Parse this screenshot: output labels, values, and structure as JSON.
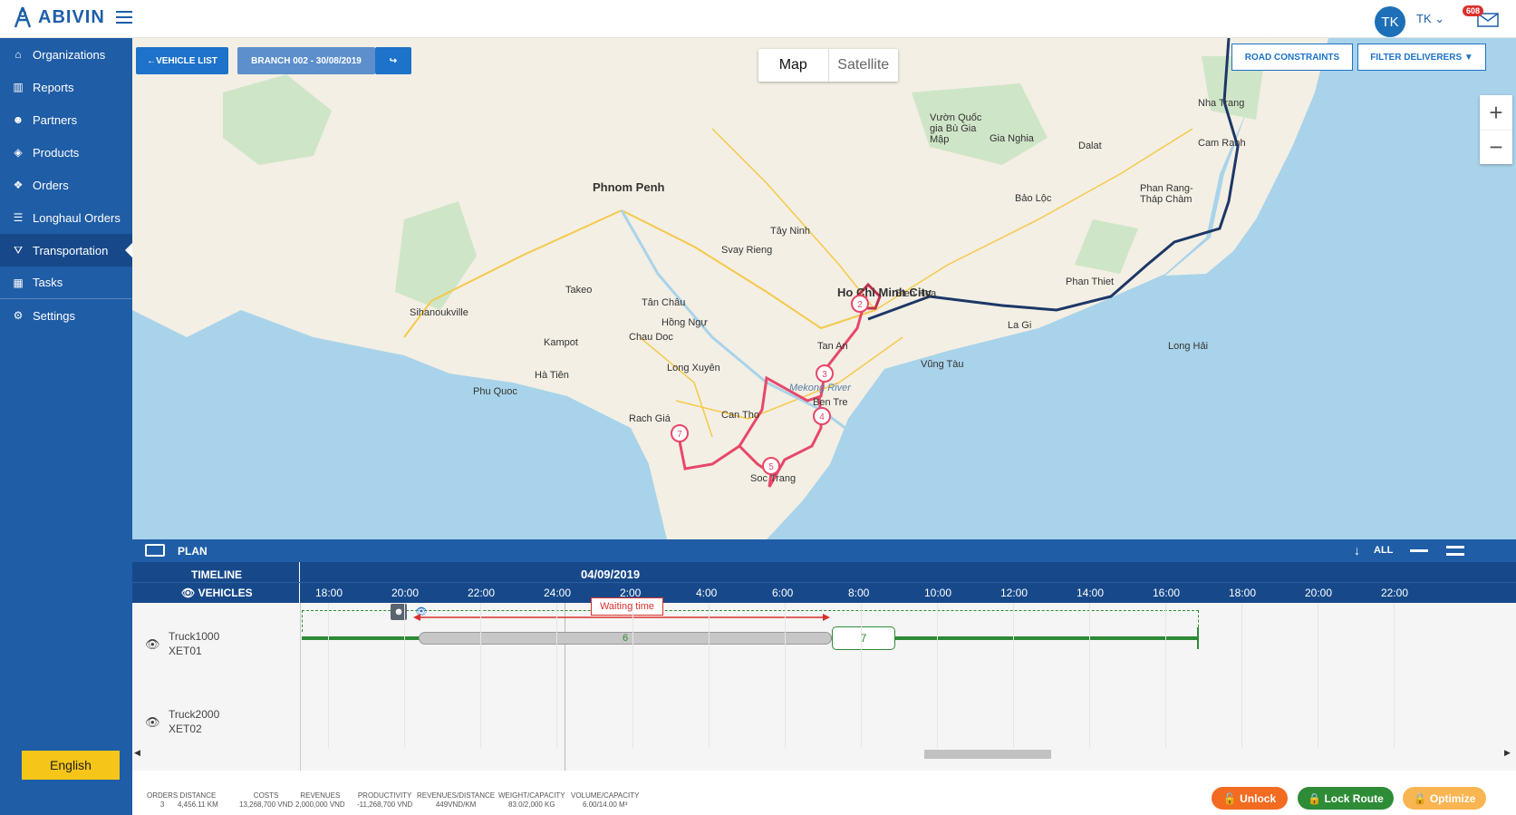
{
  "app": {
    "logo": "ABIVIN",
    "user_initials": "TK",
    "user_name": "TK",
    "notifications": "608"
  },
  "sidebar": {
    "items": [
      {
        "label": "Organizations",
        "icon": "home-icon"
      },
      {
        "label": "Reports",
        "icon": "bar-chart-icon"
      },
      {
        "label": "Partners",
        "icon": "users-icon"
      },
      {
        "label": "Products",
        "icon": "cubes-icon"
      },
      {
        "label": "Orders",
        "icon": "boxes-icon"
      },
      {
        "label": "Longhaul Orders",
        "icon": "list-icon"
      },
      {
        "label": "Transportation",
        "icon": "road-icon",
        "active": true
      },
      {
        "label": "Tasks",
        "icon": "calendar-icon"
      },
      {
        "label": "Settings",
        "icon": "gear-icon"
      }
    ],
    "language": "English"
  },
  "map": {
    "vehicle_list": "VEHICLE LIST",
    "branch": "BRANCH 002 - 30/08/2019",
    "toggle_map": "Map",
    "toggle_satellite": "Satellite",
    "road_constraints": "ROAD CONSTRAINTS",
    "filter_deliverers": "FILTER DELIVERERS",
    "labels": [
      "Phnom Penh",
      "Tây Ninh",
      "Ho Chi Minh City",
      "Bien Hoa",
      "Long Xuyên",
      "Can Tho",
      "Rach Giá",
      "Soc Trang",
      "Ben Tre",
      "Tan An",
      "Vũng Tàu",
      "Phan Thiet",
      "La Gi",
      "Nha Trang",
      "Cam Ranh",
      "Dalat",
      "Bảo Lộc",
      "Gia Nghia",
      "Phan Rang-Tháp Chàm",
      "Vườn Quốc gia Bù Gia Mập",
      "Hà Tiên",
      "Phu Quoc",
      "Kampot",
      "Sihanoukville",
      "Takeo",
      "Svay Rieng",
      "Chau Doc",
      "Tân Châu",
      "Hồng Ngự",
      "Mekong River",
      "Long Hải"
    ],
    "stops": [
      "2",
      "3",
      "4",
      "5",
      "7"
    ]
  },
  "plan": {
    "title": "PLAN",
    "all": "ALL",
    "timeline": "TIMELINE",
    "vehicles": "VEHICLES",
    "date": "04/09/2019",
    "ticks": [
      "18:00",
      "20:00",
      "22:00",
      "24:00",
      "2:00",
      "4:00",
      "6:00",
      "8:00",
      "10:00",
      "12:00",
      "14:00",
      "16:00",
      "18:00",
      "20:00",
      "22:00"
    ],
    "waiting": "Waiting time",
    "vehicle_rows": [
      {
        "name": "Truck1000",
        "code": "XET01"
      },
      {
        "name": "Truck2000",
        "code": "XET02"
      }
    ],
    "segments": [
      "6",
      "7"
    ]
  },
  "stats": [
    {
      "label": "ORDERS",
      "value": "3"
    },
    {
      "label": "DISTANCE",
      "value": "4,456.11 KM"
    },
    {
      "label": "COSTS",
      "value": "13,268,700 VND"
    },
    {
      "label": "REVENUES",
      "value": "2,000,000 VND"
    },
    {
      "label": "PRODUCTIVITY",
      "value": "-11,268,700 VND"
    },
    {
      "label": "REVENUES/DISTANCE",
      "value": "449VND/KM"
    },
    {
      "label": "WEIGHT/CAPACITY",
      "value": "83.0/2,000 KG"
    },
    {
      "label": "VOLUME/CAPACITY",
      "value": "6.00/14.00 M³"
    }
  ],
  "actions": {
    "unlock": "Unlock",
    "lock": "Lock Route",
    "optimize": "Optimize"
  },
  "colors": {
    "brand": "#1f5da6",
    "route_red": "#e8476a",
    "route_navy": "#1c3767",
    "gantt_green": "#2e8b36",
    "unlock": "#f26b21",
    "lock": "#2e8b36",
    "optimize": "#f9b552"
  }
}
